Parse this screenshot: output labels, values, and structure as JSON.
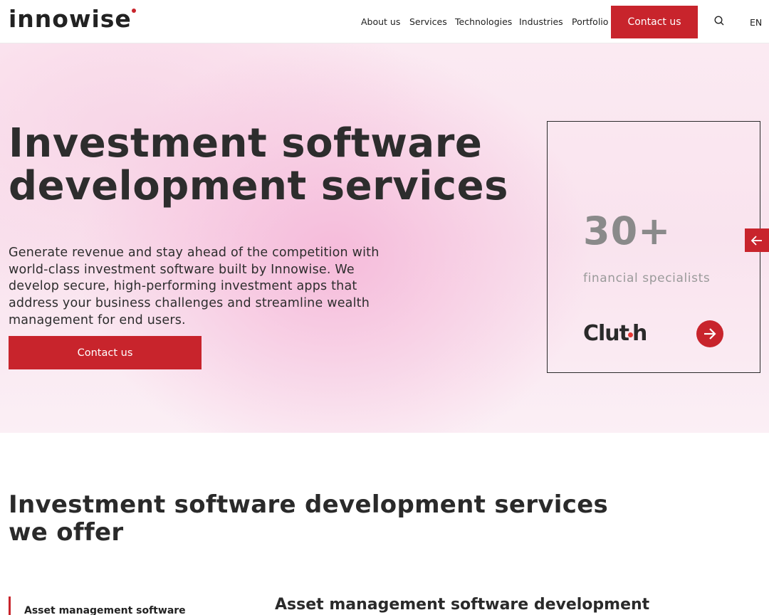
{
  "header": {
    "logo": "innowise",
    "nav": [
      "About us",
      "Services",
      "Technologies",
      "Industries",
      "Portfolio"
    ],
    "contact_label": "Contact us",
    "search_icon": "search-icon",
    "language": "EN"
  },
  "hero": {
    "title_line1": "Investment software",
    "title_line2": "development services",
    "description": "Generate revenue and stay ahead of the competition with world-class investment software built by Innowise. We develop secure, high-performing investment apps that address your business challenges and streamline wealth management for end users.",
    "cta_label": "Contact us",
    "stat_value": "30+",
    "stat_label": "financial specialists",
    "clutch_left": "Clut",
    "clutch_right": "h"
  },
  "services": {
    "title_line1": "Investment software development services",
    "title_line2": "we offer",
    "active_item": "Asset management software",
    "detail_title": "Asset management software development"
  },
  "colors": {
    "accent": "#c8242c",
    "text": "#2a2a2a",
    "muted": "#8a8a8a"
  }
}
